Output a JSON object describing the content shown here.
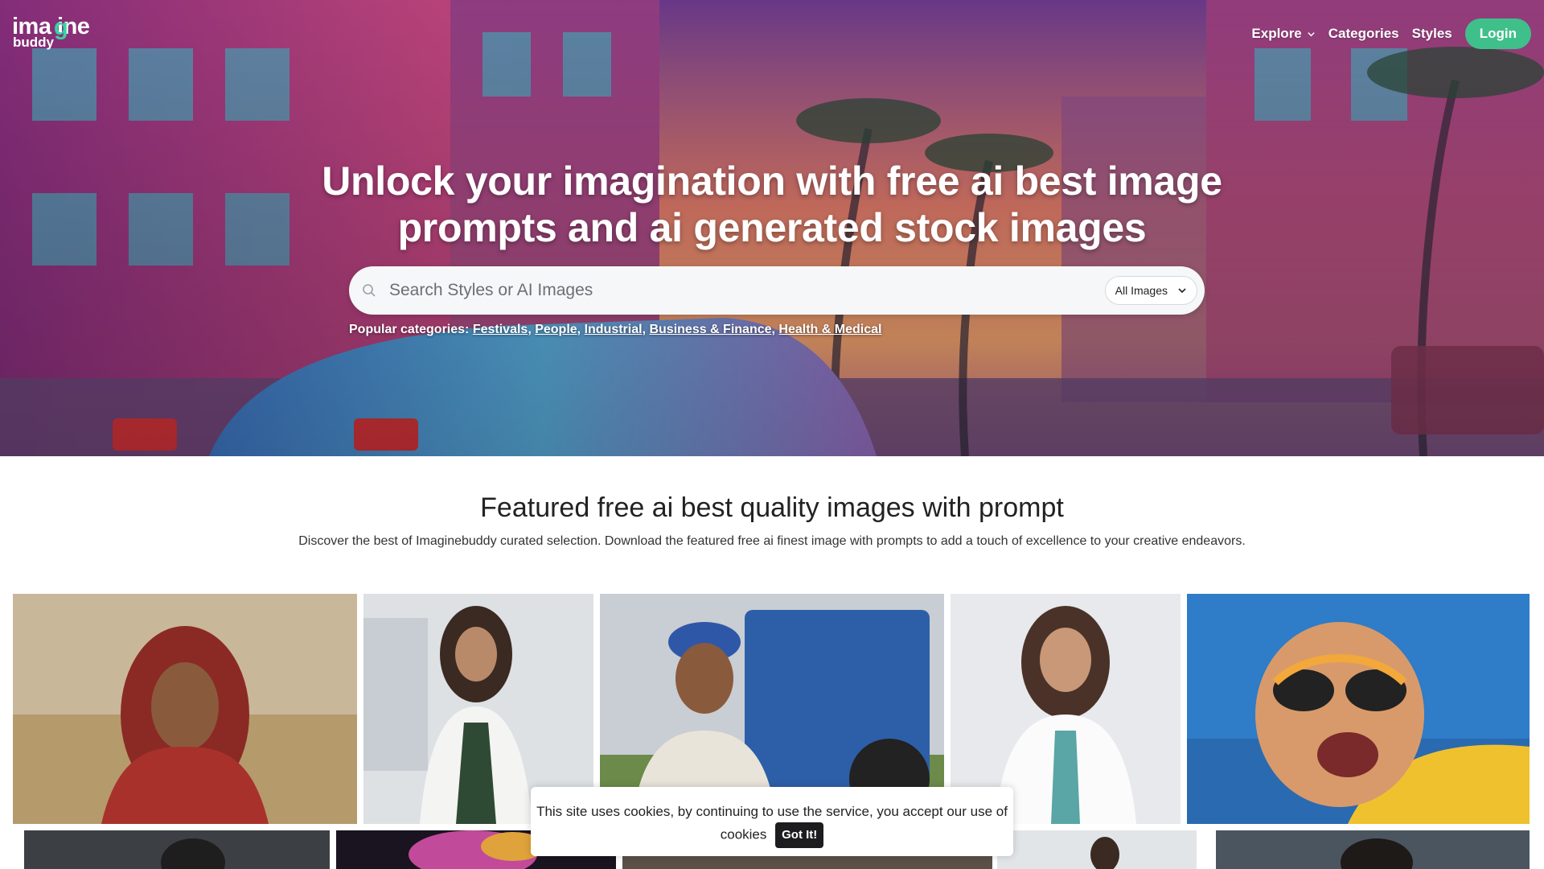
{
  "brand": {
    "logo_main": "ima  ine",
    "logo_letter": "g",
    "logo_sub": "buddy",
    "accent": "#3fc08a"
  },
  "nav": {
    "explore": "Explore",
    "categories": "Categories",
    "styles": "Styles",
    "login": "Login"
  },
  "hero": {
    "title": "Unlock your imagination with free ai best image prompts and ai generated stock images",
    "search_placeholder": "Search Styles or AI Images",
    "filter_selected": "All Images",
    "popular_label": "Popular categories:",
    "popular_links": [
      "Festivals",
      "People",
      "Industrial",
      "Business & Finance",
      "Health & Medical"
    ]
  },
  "featured": {
    "title": "Featured free ai best quality images with prompt",
    "description": "Discover the best of Imaginebuddy curated selection. Download the featured free ai finest image with prompts to add a touch of excellence to your creative endeavors."
  },
  "cookie": {
    "text": "This site uses cookies, by continuing to use the service, you accept our use of cookies",
    "button": "Got It!"
  },
  "icons": {
    "search": "search-icon",
    "chevron": "chevron-down-icon"
  }
}
